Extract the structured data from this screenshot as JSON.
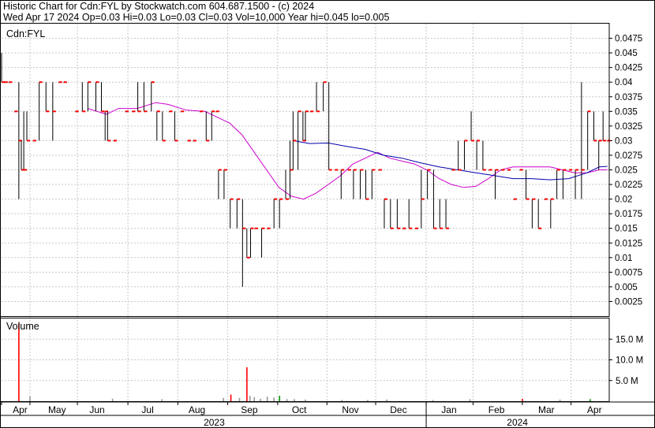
{
  "header": {
    "line1": "Historic Chart for Cdn:FYL by Stockwatch.com 604.687.1500 - (c) 2024",
    "line2": "Wed Apr 17 2024  Op=0.03  Hi=0.03  Lo=0.03  Cl=0.03  Vol=10,000  Year hi=0.045  lo=0.005"
  },
  "chart_data": [
    {
      "type": "line",
      "title": "Cdn:FYL",
      "price_ticks": [
        "0.0475",
        "0.045",
        "0.0425",
        "0.04",
        "0.0375",
        "0.035",
        "0.0325",
        "0.03",
        "0.0275",
        "0.025",
        "0.0225",
        "0.02",
        "0.0175",
        "0.015",
        "0.0125",
        "0.01",
        "0.0075",
        "0.005",
        "0.0025"
      ],
      "ylim": [
        0,
        0.05
      ],
      "x_month_labels": [
        "Apr",
        "May",
        "Jun",
        "Jul",
        "Aug",
        "Sep",
        "Oct",
        "Nov",
        "Dec",
        "Jan",
        "Feb",
        "Mar",
        "Apr"
      ],
      "x_year_labels": [
        "2023",
        "2024"
      ],
      "grid": true,
      "colors": {
        "bars": "#000000",
        "close_tick": "#ff0000",
        "ma_short": "#cc00cc",
        "ma_long": "#0000aa"
      },
      "series": [
        {
          "legend": "daily high-low bars",
          "values": [
            [
              0,
              0.04,
              0.045,
              0.04
            ],
            [
              0.5,
              0.04,
              0.04,
              0.04
            ],
            [
              1.2,
              0.04,
              0.04,
              0.04
            ],
            [
              2.1,
              0.035,
              0.035,
              0.035
            ],
            [
              2.8,
              0.02,
              0.04,
              0.03
            ],
            [
              3.2,
              0.025,
              0.03,
              0.025
            ],
            [
              3.6,
              0.025,
              0.035,
              0.025
            ],
            [
              4.1,
              0.03,
              0.035,
              0.03
            ],
            [
              5.1,
              0.03,
              0.03,
              0.03
            ],
            [
              6.1,
              0.03,
              0.04,
              0.04
            ],
            [
              7.2,
              0.035,
              0.04,
              0.035
            ],
            [
              8.3,
              0.03,
              0.04,
              0.035
            ],
            [
              9.3,
              0.04,
              0.04,
              0.04
            ],
            [
              10.1,
              0.04,
              0.04,
              0.04
            ],
            [
              12,
              0.035,
              0.035,
              0.035
            ],
            [
              13.1,
              0.035,
              0.04,
              0.035
            ],
            [
              14,
              0.035,
              0.04,
              0.04
            ],
            [
              15.3,
              0.035,
              0.04,
              0.04
            ],
            [
              16.2,
              0.035,
              0.04,
              0.035
            ],
            [
              16.8,
              0.03,
              0.035,
              0.035
            ],
            [
              17.2,
              0.03,
              0.035,
              0.03
            ],
            [
              18.2,
              0.03,
              0.03,
              0.03
            ],
            [
              20.1,
              0.035,
              0.035,
              0.035
            ],
            [
              21.2,
              0.035,
              0.035,
              0.035
            ],
            [
              22.1,
              0.035,
              0.04,
              0.035
            ],
            [
              23.1,
              0.035,
              0.04,
              0.035
            ],
            [
              24.3,
              0.035,
              0.04,
              0.04
            ],
            [
              25.2,
              0.03,
              0.035,
              0.035
            ],
            [
              26.1,
              0.03,
              0.035,
              0.03
            ],
            [
              27.2,
              0.035,
              0.035,
              0.035
            ],
            [
              28.1,
              0.03,
              0.035,
              0.03
            ],
            [
              29.1,
              0.035,
              0.035,
              0.035
            ],
            [
              30.2,
              0.03,
              0.03,
              0.03
            ],
            [
              31.1,
              0.03,
              0.03,
              0.03
            ],
            [
              32.2,
              0.035,
              0.035,
              0.035
            ],
            [
              33.2,
              0.03,
              0.035,
              0.03
            ],
            [
              34.1,
              0.03,
              0.035,
              0.035
            ],
            [
              34.8,
              0.035,
              0.035,
              0.035
            ],
            [
              35.2,
              0.02,
              0.025,
              0.025
            ],
            [
              36.1,
              0.02,
              0.025,
              0.025
            ],
            [
              37.1,
              0.015,
              0.02,
              0.02
            ],
            [
              38.2,
              0.015,
              0.02,
              0.02
            ],
            [
              39.1,
              0.005,
              0.02,
              0.015
            ],
            [
              39.8,
              0.01,
              0.015,
              0.01
            ],
            [
              40.4,
              0.01,
              0.015,
              0.015
            ],
            [
              41.1,
              0.015,
              0.015,
              0.015
            ],
            [
              42.2,
              0.01,
              0.015,
              0.015
            ],
            [
              43.1,
              0.015,
              0.015,
              0.015
            ],
            [
              44.2,
              0.015,
              0.02,
              0.02
            ],
            [
              45.1,
              0.015,
              0.02,
              0.02
            ],
            [
              46.1,
              0.02,
              0.025,
              0.02
            ],
            [
              46.8,
              0.02,
              0.03,
              0.025
            ],
            [
              47.3,
              0.025,
              0.035,
              0.03
            ],
            [
              48.1,
              0.025,
              0.035,
              0.035
            ],
            [
              48.9,
              0.03,
              0.035,
              0.03
            ],
            [
              49.3,
              0.03,
              0.035,
              0.035
            ],
            [
              50.1,
              0.035,
              0.035,
              0.035
            ],
            [
              51.1,
              0.035,
              0.04,
              0.035
            ],
            [
              52.2,
              0.035,
              0.04,
              0.04
            ],
            [
              53.1,
              0.025,
              0.04,
              0.025
            ],
            [
              54.1,
              0.025,
              0.025,
              0.025
            ],
            [
              55.1,
              0.02,
              0.025,
              0.025
            ],
            [
              56.2,
              0.025,
              0.025,
              0.025
            ],
            [
              57.1,
              0.02,
              0.025,
              0.025
            ],
            [
              58.2,
              0.02,
              0.025,
              0.025
            ],
            [
              59.1,
              0.02,
              0.025,
              0.02
            ],
            [
              60.1,
              0.02,
              0.025,
              0.025
            ],
            [
              61.2,
              0.025,
              0.025,
              0.025
            ],
            [
              62.1,
              0.015,
              0.02,
              0.02
            ],
            [
              63.1,
              0.015,
              0.02,
              0.015
            ],
            [
              64.2,
              0.015,
              0.02,
              0.015
            ],
            [
              65.1,
              0.015,
              0.015,
              0.015
            ],
            [
              66.1,
              0.015,
              0.02,
              0.015
            ],
            [
              67.1,
              0.015,
              0.015,
              0.015
            ],
            [
              68.1,
              0.015,
              0.025,
              0.02
            ],
            [
              69.1,
              0.02,
              0.025,
              0.025
            ],
            [
              70.1,
              0.015,
              0.025,
              0.015
            ],
            [
              71.1,
              0.015,
              0.02,
              0.015
            ],
            [
              72.1,
              0.015,
              0.02,
              0.015
            ],
            [
              73.1,
              0.025,
              0.025,
              0.025
            ],
            [
              74.1,
              0.025,
              0.03,
              0.025
            ],
            [
              75.1,
              0.025,
              0.03,
              0.03
            ],
            [
              76.2,
              0.03,
              0.035,
              0.03
            ],
            [
              77.1,
              0.025,
              0.03,
              0.03
            ],
            [
              78.1,
              0.025,
              0.03,
              0.025
            ],
            [
              79.1,
              0.025,
              0.025,
              0.025
            ],
            [
              80.1,
              0.02,
              0.025,
              0.025
            ],
            [
              81.1,
              0.025,
              0.025,
              0.025
            ],
            [
              82.1,
              0.025,
              0.025,
              0.025
            ],
            [
              83.1,
              0.02,
              0.02,
              0.02
            ],
            [
              84.1,
              0.025,
              0.025,
              0.025
            ],
            [
              85.1,
              0.02,
              0.025,
              0.02
            ],
            [
              86.1,
              0.015,
              0.02,
              0.02
            ],
            [
              87.1,
              0.015,
              0.02,
              0.015
            ],
            [
              88.1,
              0.02,
              0.02,
              0.02
            ],
            [
              89.1,
              0.015,
              0.02,
              0.02
            ],
            [
              90.1,
              0.02,
              0.025,
              0.025
            ],
            [
              91.1,
              0.02,
              0.025,
              0.025
            ],
            [
              92.1,
              0.025,
              0.025,
              0.025
            ],
            [
              93.1,
              0.02,
              0.025,
              0.025
            ],
            [
              94.1,
              0.02,
              0.04,
              0.025
            ],
            [
              95.1,
              0.025,
              0.035,
              0.035
            ],
            [
              96.1,
              0.03,
              0.035,
              0.03
            ],
            [
              96.9,
              0.025,
              0.03,
              0.03
            ],
            [
              97.6,
              0.03,
              0.035,
              0.03
            ],
            [
              98.3,
              0.03,
              0.03,
              0.03
            ]
          ]
        },
        {
          "legend": "short moving average",
          "values": [
            [
              14,
              0.0355
            ],
            [
              17,
              0.0345
            ],
            [
              19,
              0.0355
            ],
            [
              22,
              0.0355
            ],
            [
              25,
              0.0365
            ],
            [
              27,
              0.0362
            ],
            [
              30,
              0.0352
            ],
            [
              33,
              0.035
            ],
            [
              35,
              0.034
            ],
            [
              37,
              0.033
            ],
            [
              39,
              0.031
            ],
            [
              41,
              0.028
            ],
            [
              43,
              0.025
            ],
            [
              45,
              0.022
            ],
            [
              47,
              0.0205
            ],
            [
              49,
              0.02
            ],
            [
              51,
              0.021
            ],
            [
              53,
              0.0225
            ],
            [
              55,
              0.024
            ],
            [
              57,
              0.026
            ],
            [
              59,
              0.027
            ],
            [
              61,
              0.028
            ],
            [
              63,
              0.027
            ],
            [
              65,
              0.0265
            ],
            [
              67,
              0.026
            ],
            [
              69,
              0.025
            ],
            [
              71,
              0.0235
            ],
            [
              73,
              0.0225
            ],
            [
              75,
              0.022
            ],
            [
              77,
              0.0222
            ],
            [
              79,
              0.0235
            ],
            [
              81,
              0.025
            ],
            [
              83,
              0.0255
            ],
            [
              85,
              0.0255
            ],
            [
              87,
              0.0255
            ],
            [
              89,
              0.0255
            ],
            [
              91,
              0.025
            ],
            [
              93,
              0.0245
            ],
            [
              95,
              0.0245
            ],
            [
              97,
              0.025
            ],
            [
              98.3,
              0.025
            ]
          ]
        },
        {
          "legend": "long moving average",
          "values": [
            [
              47.3,
              0.03
            ],
            [
              50,
              0.0295
            ],
            [
              53,
              0.0296
            ],
            [
              56,
              0.029
            ],
            [
              59,
              0.0285
            ],
            [
              62,
              0.0275
            ],
            [
              65,
              0.027
            ],
            [
              68,
              0.0262
            ],
            [
              71,
              0.0255
            ],
            [
              74,
              0.025
            ],
            [
              77,
              0.0245
            ],
            [
              80,
              0.024
            ],
            [
              83,
              0.0235
            ],
            [
              86,
              0.0235
            ],
            [
              89,
              0.0233
            ],
            [
              92,
              0.0235
            ],
            [
              95,
              0.0245
            ],
            [
              97,
              0.0255
            ],
            [
              98.3,
              0.0256
            ]
          ]
        }
      ]
    },
    {
      "type": "bar",
      "title": "Volume",
      "volume_ticks": [
        "15.0 M",
        "10.0 M",
        "5.0 M"
      ],
      "ylim": [
        0,
        20
      ],
      "units": "M",
      "bars": [
        {
          "x": 2.8,
          "v": 18.8,
          "c": "#ff0000"
        },
        {
          "x": 4.6,
          "v": 1.2,
          "c": "#999999"
        },
        {
          "x": 18,
          "v": 0.6,
          "c": "#999999"
        },
        {
          "x": 26,
          "v": 0.5,
          "c": "#999999"
        },
        {
          "x": 36,
          "v": 0.8,
          "c": "#999999"
        },
        {
          "x": 37.2,
          "v": 1.6,
          "c": "#ff0000"
        },
        {
          "x": 38.6,
          "v": 0.8,
          "c": "#999999"
        },
        {
          "x": 39.8,
          "v": 8.2,
          "c": "#ff0000"
        },
        {
          "x": 40.3,
          "v": 1.3,
          "c": "#999999"
        },
        {
          "x": 41,
          "v": 1.0,
          "c": "#999999"
        },
        {
          "x": 42,
          "v": 0.6,
          "c": "#999999"
        },
        {
          "x": 43.1,
          "v": 1.1,
          "c": "#999999"
        },
        {
          "x": 44.2,
          "v": 0.9,
          "c": "#999999"
        },
        {
          "x": 45.1,
          "v": 1.3,
          "c": "#009900"
        },
        {
          "x": 46.3,
          "v": 0.5,
          "c": "#999999"
        },
        {
          "x": 47.5,
          "v": 0.5,
          "c": "#999999"
        },
        {
          "x": 49.3,
          "v": 0.4,
          "c": "#999999"
        },
        {
          "x": 55.2,
          "v": 0.3,
          "c": "#999999"
        },
        {
          "x": 59.4,
          "v": 0.3,
          "c": "#999999"
        },
        {
          "x": 62.5,
          "v": 0.4,
          "c": "#999999"
        },
        {
          "x": 70,
          "v": 0.3,
          "c": "#999999"
        },
        {
          "x": 76,
          "v": 0.5,
          "c": "#999999"
        },
        {
          "x": 84.5,
          "v": 0.6,
          "c": "#ff0000"
        },
        {
          "x": 90.6,
          "v": 0.4,
          "c": "#999999"
        },
        {
          "x": 95.5,
          "v": 0.5,
          "c": "#009900"
        }
      ]
    }
  ]
}
